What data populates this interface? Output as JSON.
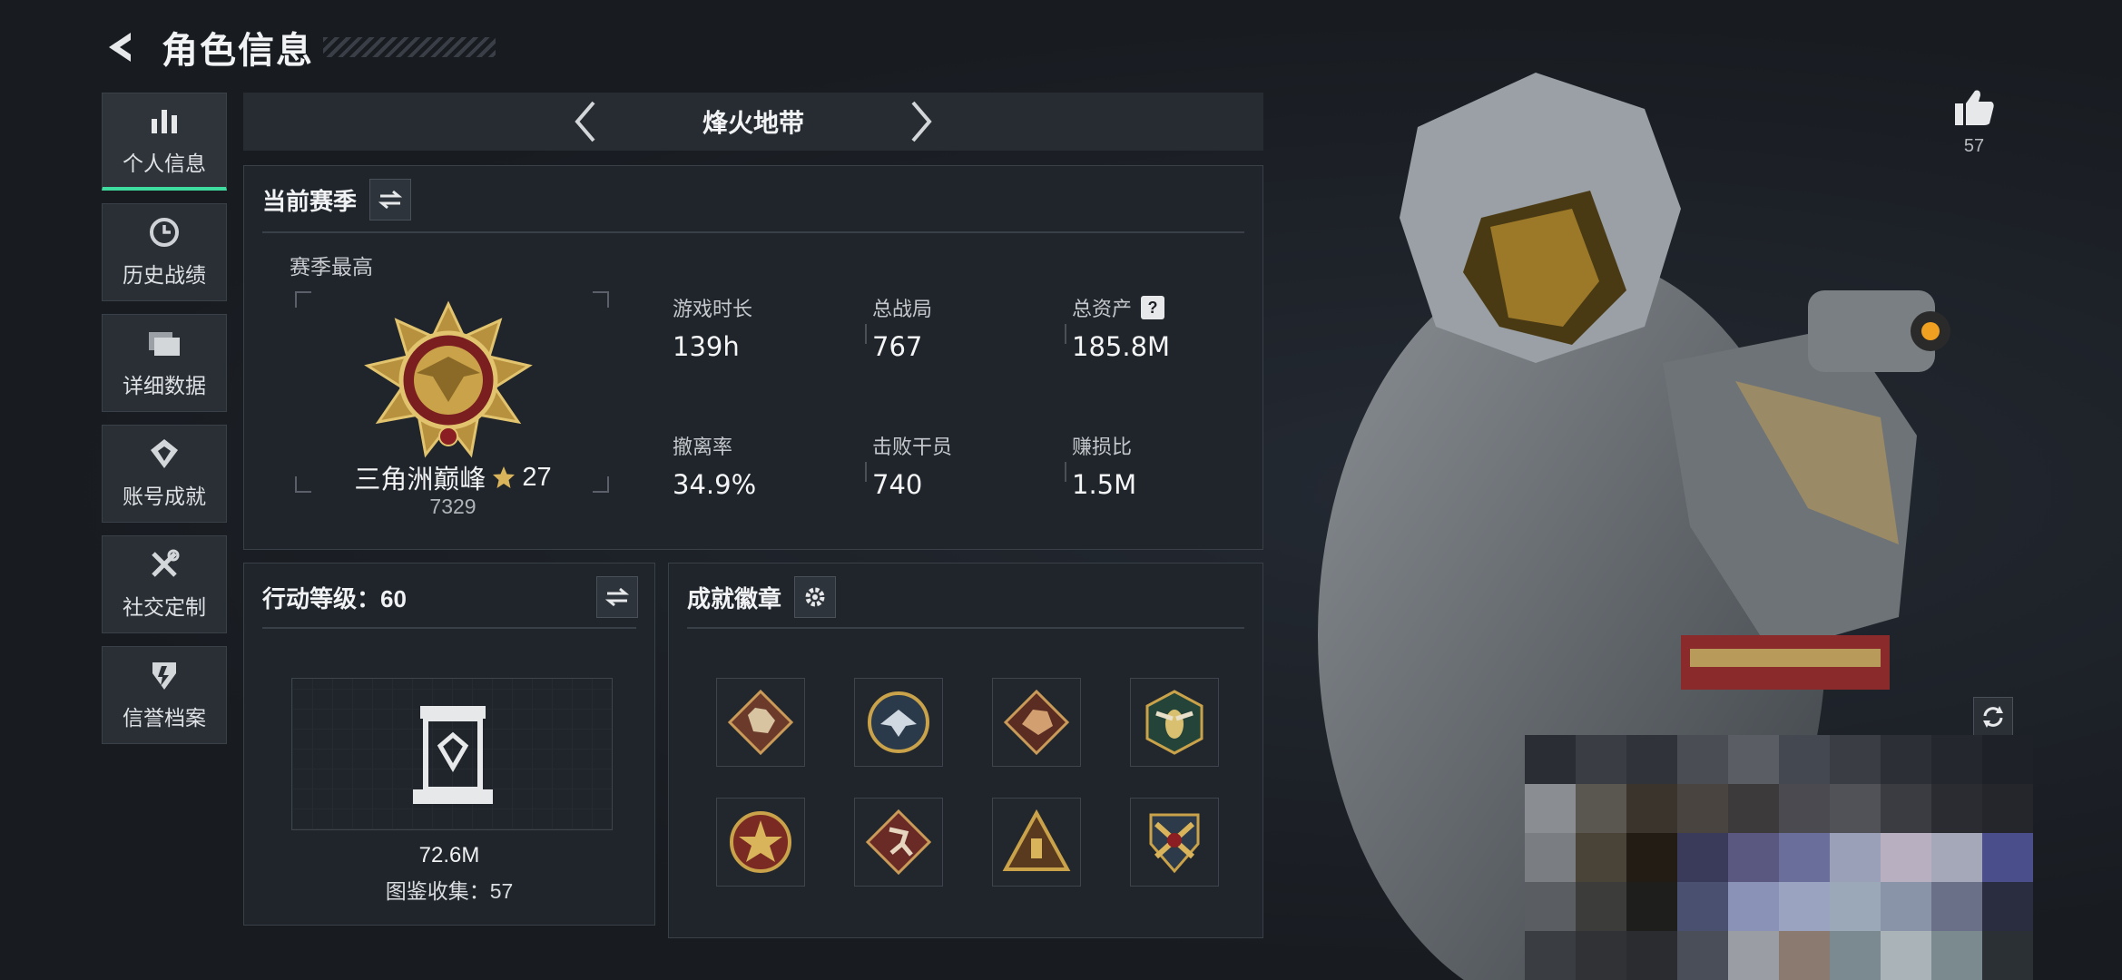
{
  "header": {
    "title": "角色信息"
  },
  "nav": {
    "items": [
      {
        "label": "个人信息",
        "icon": "bar-chart-icon",
        "active": true
      },
      {
        "label": "历史战绩",
        "icon": "clock-icon",
        "active": false
      },
      {
        "label": "详细数据",
        "icon": "folder-icon",
        "active": false
      },
      {
        "label": "账号成就",
        "icon": "achievement-icon",
        "active": false
      },
      {
        "label": "社交定制",
        "icon": "tools-icon",
        "active": false
      },
      {
        "label": "信誉档案",
        "icon": "shield-icon",
        "active": false
      }
    ]
  },
  "map_selector": {
    "current": "烽火地带"
  },
  "season_panel": {
    "title": "当前赛季",
    "season_best_label": "赛季最高",
    "rank_name": "三角洲巅峰",
    "rank_stars": "27",
    "rank_score": "7329",
    "stats": [
      {
        "label": "游戏时长",
        "value": "139h"
      },
      {
        "label": "总战局",
        "value": "767"
      },
      {
        "label": "总资产",
        "value": "185.8M",
        "help": "?"
      },
      {
        "label": "撤离率",
        "value": "34.9%"
      },
      {
        "label": "击败干员",
        "value": "740"
      },
      {
        "label": "赚损比",
        "value": "1.5M"
      }
    ]
  },
  "level_panel": {
    "title": "行动等级：60",
    "value": "72.6M",
    "collection": "图鉴收集：57"
  },
  "badge_panel": {
    "title": "成就徽章",
    "badges": [
      "wolf-badge-icon",
      "eagle-badge-icon",
      "dragon-badge-icon",
      "hornet-badge-icon",
      "star-badge-icon",
      "runner-badge-icon",
      "triangle-badge-icon",
      "crossed-guns-badge-icon"
    ]
  },
  "likes": {
    "count": "57"
  },
  "colors": {
    "accent": "#3fdca0",
    "panel": "#20252b",
    "gold": "#c9a24a"
  }
}
